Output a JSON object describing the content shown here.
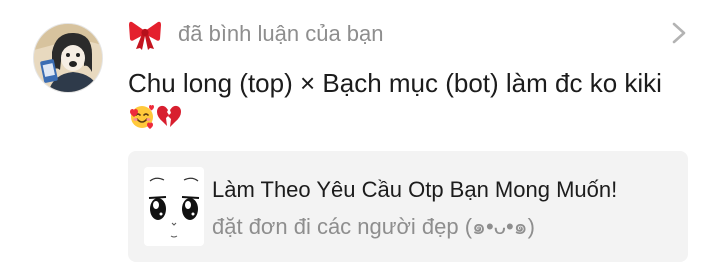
{
  "notification": {
    "action_text": "đã bình luận của bạn",
    "comment_text": "Chu long (top) × Bạch mục (bot) làm đc ko kiki",
    "comment_emojis": [
      "smiling-face-with-hearts",
      "broken-heart"
    ],
    "icon": "ribbon-bow-icon",
    "chevron_icon": "chevron-right-icon"
  },
  "card": {
    "title": "Làm Theo Yêu Cầu Otp Bạn Mong Muốn!",
    "subtitle": "đặt đơn đi các người đẹp (๑•ᴗ•๑)"
  },
  "colors": {
    "secondary_text": "#8e8e8e",
    "primary_text": "#1c1c1c",
    "card_background": "#f3f3f3",
    "bow": "#e4202d"
  }
}
